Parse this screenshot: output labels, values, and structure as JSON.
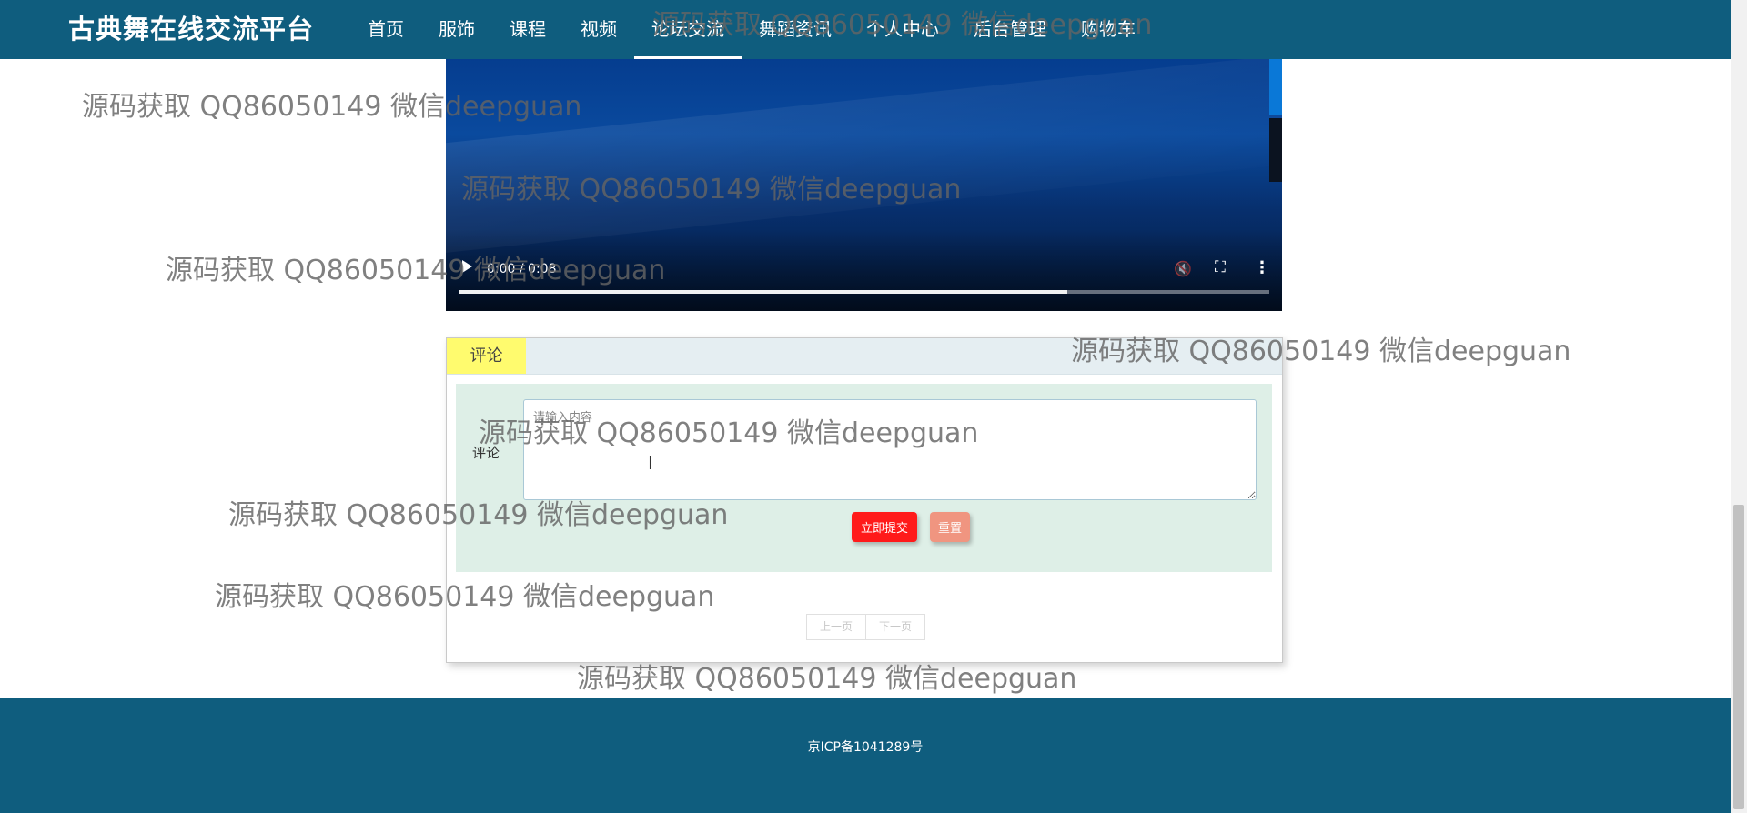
{
  "header": {
    "brand": "古典舞在线交流平台",
    "nav": [
      {
        "label": "首页"
      },
      {
        "label": "服饰"
      },
      {
        "label": "课程"
      },
      {
        "label": "视频"
      },
      {
        "label": "论坛交流",
        "active": true
      },
      {
        "label": "舞蹈资讯"
      },
      {
        "label": "个人中心"
      },
      {
        "label": "后台管理"
      },
      {
        "label": "购物车"
      }
    ],
    "background_color": "#0f5d7e"
  },
  "video": {
    "time": "0:00 / 0:08",
    "progress_fraction": 0.75,
    "controls": {
      "play": "play-icon",
      "mute": "volume-icon",
      "fullscreen": "fullscreen-icon",
      "more": "more-vertical-icon"
    }
  },
  "comment": {
    "tab_label": "评论",
    "tab_color": "#fffb6e",
    "field_label": "评论",
    "input_placeholder": "请输入内容",
    "input_value": "",
    "submit_label": "立即提交",
    "submit_color": "#ff1a1a",
    "reset_label": "重置",
    "reset_color": "#f09580",
    "prev_label": "上一页",
    "next_label": "下一页"
  },
  "footer": {
    "text": "京ICP备1041289号"
  },
  "watermark": {
    "text": "源码获取 QQ86050149 微信deepguan"
  }
}
